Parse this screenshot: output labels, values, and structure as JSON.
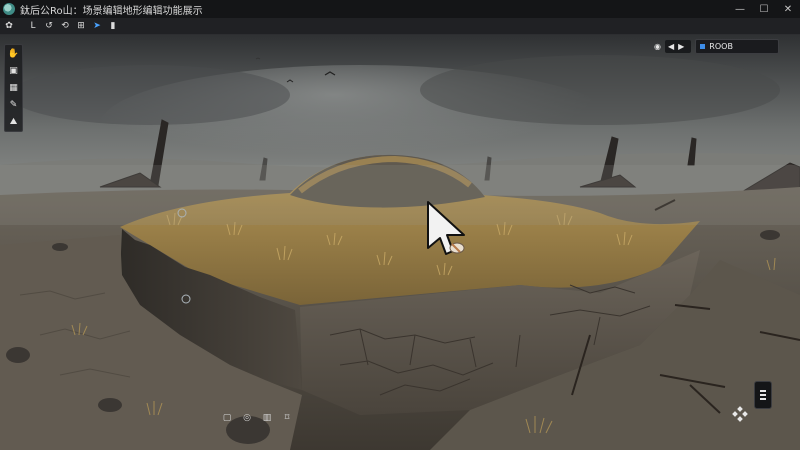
{
  "window": {
    "title": "鈦后公Ro山：场景编辑地形编辑功能展示",
    "logo_icon": "app-logo-icon",
    "minimize_label": "—",
    "maximize_label": "☐",
    "close_label": "✕"
  },
  "toolbar": {
    "buttons": [
      {
        "name": "settings-icon",
        "glyph": "✿"
      },
      {
        "name": "move-tool-icon",
        "glyph": "L"
      },
      {
        "name": "rotate-tool-icon",
        "glyph": "↺"
      },
      {
        "name": "undo-icon",
        "glyph": "⟲"
      },
      {
        "name": "layout-icon",
        "glyph": "⊞"
      },
      {
        "name": "send-icon",
        "glyph": "➤"
      },
      {
        "name": "panel-icon",
        "glyph": "▮"
      }
    ]
  },
  "left_palette": {
    "buttons": [
      {
        "name": "hand-tool-icon",
        "glyph": "✋"
      },
      {
        "name": "select-box-icon",
        "glyph": "▣"
      },
      {
        "name": "grid-icon",
        "glyph": "▦"
      },
      {
        "name": "paint-icon",
        "glyph": "✎"
      },
      {
        "name": "terrain-tool-icon",
        "glyph": "⛰"
      }
    ]
  },
  "top_right": {
    "buttons": [
      {
        "name": "camera-icon",
        "glyph": "◉"
      },
      {
        "name": "audio-icon",
        "glyph": "◀"
      },
      {
        "name": "video-icon",
        "glyph": "▶"
      }
    ],
    "scene_field_value": "ROOB"
  },
  "bottom_bar": {
    "buttons": [
      {
        "name": "select-icon",
        "glyph": "▢"
      },
      {
        "name": "target-icon",
        "glyph": "◎"
      },
      {
        "name": "book-icon",
        "glyph": "▥"
      },
      {
        "name": "bookmark-icon",
        "glyph": "⌑"
      }
    ]
  },
  "colors": {
    "sky_top": "#3c3e40",
    "sky_horizon": "#8e9190",
    "ground": "#5c554b",
    "grass": "#a98b4c",
    "accent": "#3d8de8"
  }
}
